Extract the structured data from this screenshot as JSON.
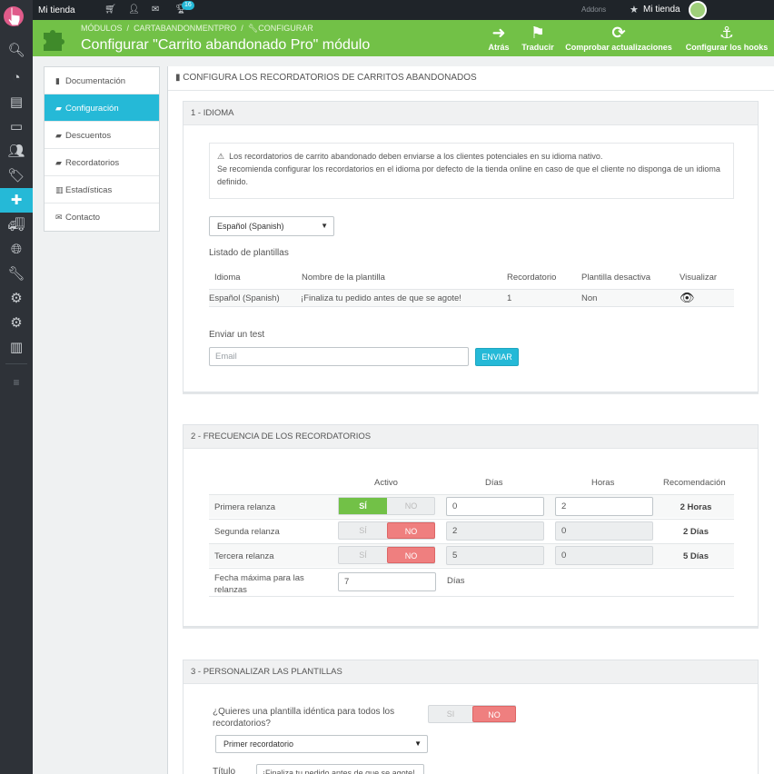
{
  "topbar": {
    "shop_name": "Mi tienda",
    "notif_count": "16",
    "addons": "Addons",
    "shop_link": "Mi tienda"
  },
  "header": {
    "breadcrumb": [
      "MÓDULOS",
      "/",
      "CARTABANDONMENTPRO",
      "/",
      "CONFIGURAR"
    ],
    "title": "Configurar \"Carrito abandonado Pro\" módulo",
    "buttons": {
      "back": "Atrás",
      "translate": "Traducir",
      "updates": "Comprobar actualizaciones",
      "hooks": "Configurar los hooks"
    }
  },
  "sidebar": {
    "icons": [
      "dashboard-icon",
      "catalog-icon",
      "orders-icon",
      "customers-icon",
      "tags-icon",
      "modules-icon",
      "shipping-icon",
      "localization-icon",
      "tools-icon",
      "advanced-icon",
      "settings-icon",
      "stats-icon",
      "menu-icon"
    ]
  },
  "nav": {
    "items": [
      {
        "label": "Documentación",
        "icon": "book-icon"
      },
      {
        "label": "Configuración",
        "icon": "briefcase-icon"
      },
      {
        "label": "Descuentos",
        "icon": "briefcase-icon"
      },
      {
        "label": "Recordatorios",
        "icon": "briefcase-icon"
      },
      {
        "label": "Estadísticas",
        "icon": "bar-chart-icon"
      },
      {
        "label": "Contacto",
        "icon": "envelope-icon"
      }
    ]
  },
  "main": {
    "title": "CONFIGURA LOS RECORDATORIOS DE CARRITOS ABANDONADOS"
  },
  "idioma": {
    "heading": "1 - IDIOMA",
    "alert_line1": "Los recordatorios de carrito abandonado deben enviarse a los clientes potenciales en su idioma nativo.",
    "alert_line2": "Se recomienda configurar los recordatorios en el idioma por defecto de la tienda online en caso de que el cliente no disponga de un idioma definido.",
    "language": "Español (Spanish)",
    "templates_title": "Listado de plantillas",
    "columns": [
      "Idioma",
      "Nombre de la plantilla",
      "Recordatorio",
      "Plantilla desactiva",
      "Visualizar"
    ],
    "row": {
      "lang": "Español (Spanish)",
      "name": "¡Finaliza tu pedido antes de que se agote!",
      "reminder": "1",
      "disabled": "Non"
    },
    "test_title": "Enviar un test",
    "email_placeholder": "Email",
    "send": "ENVIAR"
  },
  "frecuencia": {
    "heading": "2 - FRECUENCIA DE LOS RECORDATORIOS",
    "columns": {
      "activo": "Activo",
      "dias": "Días",
      "horas": "Horas",
      "rec": "Recomendación"
    },
    "yes": "SÍ",
    "no": "NO",
    "rows": [
      {
        "label": "Primera relanza",
        "active": true,
        "days": "0",
        "hours": "2",
        "rec": "2 Horas"
      },
      {
        "label": "Segunda relanza",
        "active": false,
        "days": "2",
        "hours": "0",
        "rec": "2 Días"
      },
      {
        "label": "Tercera relanza",
        "active": false,
        "days": "5",
        "hours": "0",
        "rec": "5 Días"
      }
    ],
    "max_label_1": "Fecha máxima para las",
    "max_label_2": "relanzas",
    "max_value": "7",
    "max_unit": "Días"
  },
  "plantillas": {
    "heading": "3 - PERSONALIZAR LAS PLANTILLAS",
    "question_1": "¿Quieres una plantilla idéntica para todos los",
    "question_2": "recordatorios?",
    "yes": "SI",
    "no": "NO",
    "reminder_select": "Primer recordatorio",
    "title_label": "Título",
    "title_value": "¡Finaliza tu pedido antes de que se agote!"
  }
}
